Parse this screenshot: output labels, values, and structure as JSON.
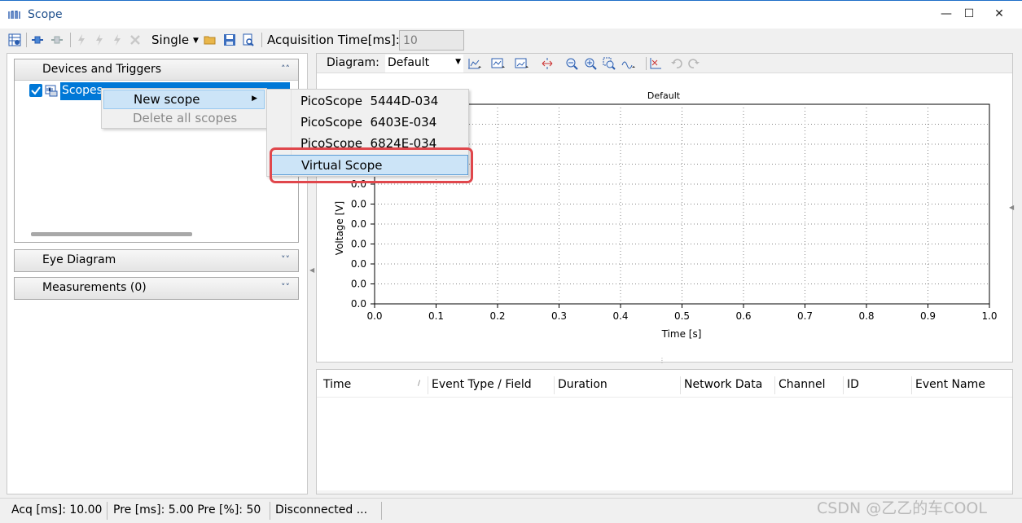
{
  "window": {
    "title": "Scope"
  },
  "toolbar": {
    "mode_label": "Single",
    "acq_time_label": "Acquisition Time[ms]:",
    "acq_time_value": "10"
  },
  "left": {
    "devices_group": "Devices and Triggers",
    "tree_root": "Scopes",
    "eye_group": "Eye Diagram",
    "measurements_group": "Measurements (0)"
  },
  "context_menu": {
    "new_scope": "New scope",
    "delete_all": "Delete all scopes"
  },
  "submenu": {
    "items": [
      {
        "label": "PicoScope  5444D-034"
      },
      {
        "label": "PicoScope  6403E-034"
      },
      {
        "label": "PicoScope  6824E-034"
      },
      {
        "label": "Virtual Scope"
      }
    ]
  },
  "diagram": {
    "label": "Diagram:",
    "selected": "Default"
  },
  "chart_data": {
    "type": "line",
    "title": "Default",
    "xlabel": "Time [s]",
    "ylabel": "Voltage [V]",
    "xlim": [
      0,
      1
    ],
    "x_ticks": [
      "0.0",
      "0.1",
      "0.2",
      "0.3",
      "0.4",
      "0.5",
      "0.6",
      "0.7",
      "0.8",
      "0.9",
      "1.0"
    ],
    "y_ticks_visible": [
      "0.0",
      "0.0",
      "0.0",
      "0.0",
      "0.0",
      "0.0",
      "0.0"
    ],
    "grid": true,
    "series": []
  },
  "table": {
    "columns": [
      "Time",
      "Event Type / Field",
      "Duration",
      "Network Data",
      "Channel",
      "ID",
      "Event Name"
    ]
  },
  "status": {
    "acq": "Acq [ms]: 10.00",
    "pre": "Pre [ms]:  5.00 Pre [%]:  50",
    "conn": "Disconnected ..."
  },
  "watermark": "CSDN @乙乙的车COOL",
  "colors": {
    "selection": "#0078d7",
    "highlight_box": "#e0474c",
    "menu_hover": "#cce4f7"
  }
}
